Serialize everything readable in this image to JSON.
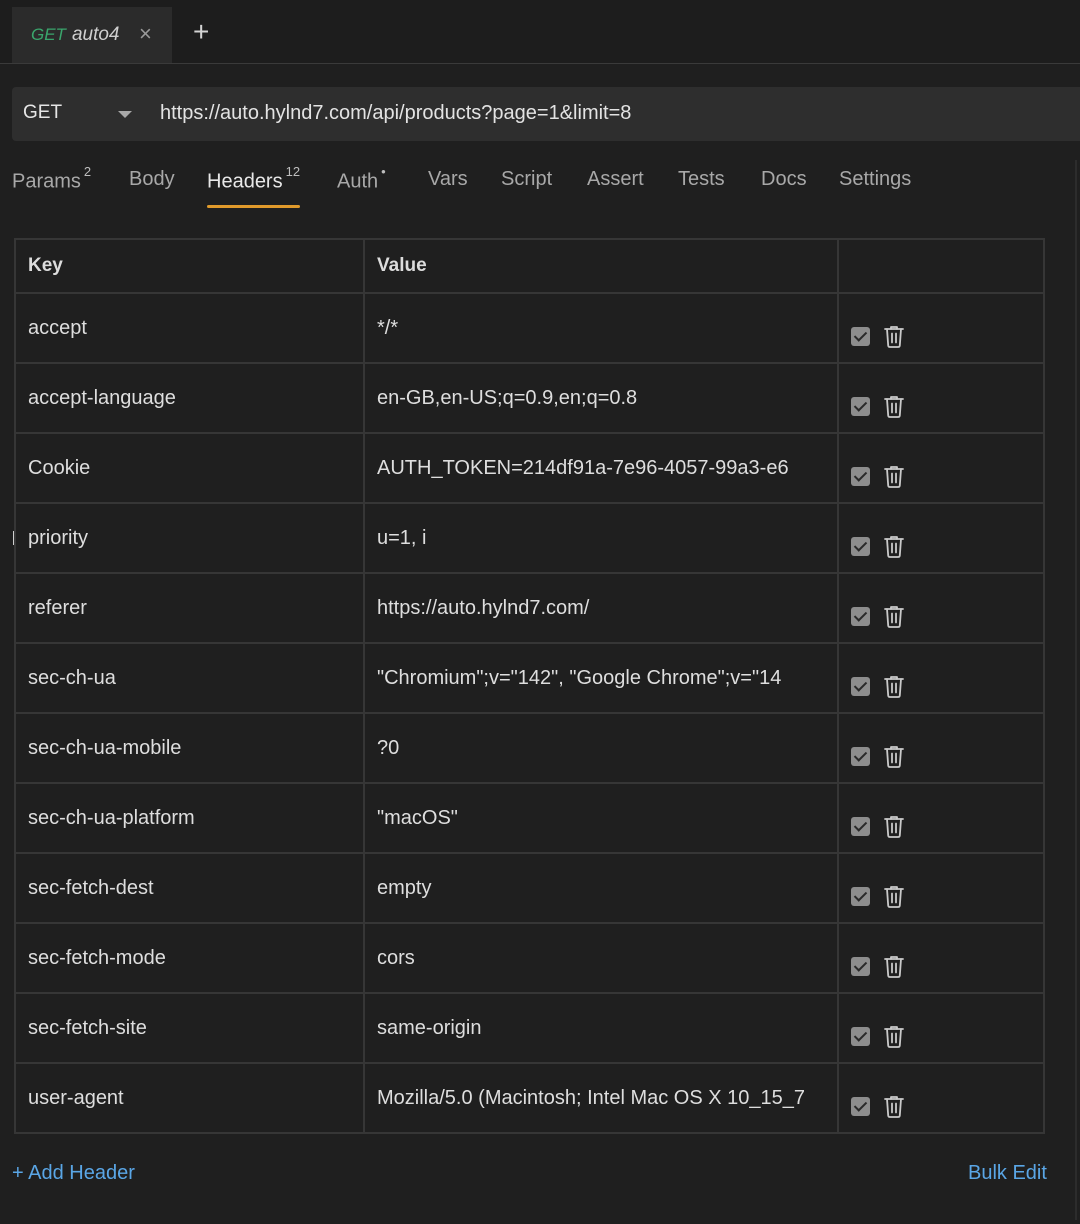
{
  "tab": {
    "method": "GET",
    "name": "auto4",
    "close_glyph": "×",
    "new_glyph": "+"
  },
  "request": {
    "method": "GET",
    "url": "https://auto.hylnd7.com/api/products?page=1&limit=8"
  },
  "request_tabs": [
    {
      "label": "Params",
      "badge": "2"
    },
    {
      "label": "Body",
      "badge": ""
    },
    {
      "label": "Headers",
      "badge": "12",
      "active": true
    },
    {
      "label": "Auth",
      "badge": "•"
    },
    {
      "label": "Vars",
      "badge": ""
    },
    {
      "label": "Script",
      "badge": ""
    },
    {
      "label": "Assert",
      "badge": ""
    },
    {
      "label": "Tests",
      "badge": ""
    },
    {
      "label": "Docs",
      "badge": ""
    },
    {
      "label": "Settings",
      "badge": ""
    }
  ],
  "table": {
    "columns": {
      "key": "Key",
      "value": "Value",
      "actions": ""
    },
    "rows": [
      {
        "key": "accept",
        "value": "*/*",
        "enabled": true
      },
      {
        "key": "accept-language",
        "value": "en-GB,en-US;q=0.9,en;q=0.8",
        "enabled": true
      },
      {
        "key": "Cookie",
        "value": "AUTH_TOKEN=214df91a-7e96-4057-99a3-e6",
        "enabled": true
      },
      {
        "key": "priority",
        "value": "u=1, i",
        "enabled": true
      },
      {
        "key": "referer",
        "value": "https://auto.hylnd7.com/",
        "enabled": true
      },
      {
        "key": "sec-ch-ua",
        "value": "\"Chromium\";v=\"142\", \"Google Chrome\";v=\"14",
        "enabled": true
      },
      {
        "key": "sec-ch-ua-mobile",
        "value": "?0",
        "enabled": true
      },
      {
        "key": "sec-ch-ua-platform",
        "value": "\"macOS\"",
        "enabled": true
      },
      {
        "key": "sec-fetch-dest",
        "value": "empty",
        "enabled": true
      },
      {
        "key": "sec-fetch-mode",
        "value": "cors",
        "enabled": true
      },
      {
        "key": "sec-fetch-site",
        "value": "same-origin",
        "enabled": true
      },
      {
        "key": "user-agent",
        "value": "Mozilla/5.0 (Macintosh; Intel Mac OS X 10_15_7",
        "enabled": true
      }
    ]
  },
  "footer": {
    "add_label": "+ Add Header",
    "bulk_label": "Bulk Edit"
  },
  "colors": {
    "accent_underline": "#e09a2b",
    "link": "#5aa6e6",
    "method_get": "#3aa56c"
  }
}
